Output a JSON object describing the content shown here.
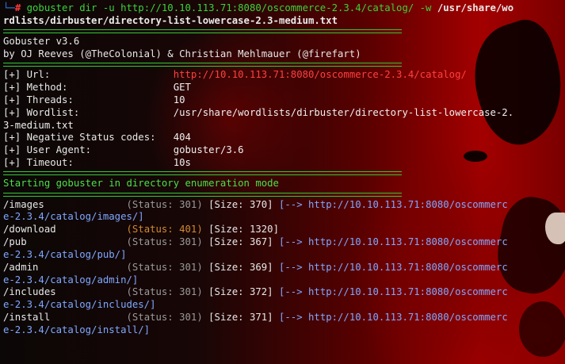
{
  "prompt": {
    "corner": "└─",
    "hash": "#",
    "command_start": "gobuster dir -u http://10.10.113.71:8080/oscommerce-2.3.4/catalog/ -w ",
    "wordlist_line1": "/usr/share/wo",
    "wordlist_line2": "rdlists/dirbuster/directory-list-lowercase-2.3-medium.txt"
  },
  "banner": {
    "version": "Gobuster v3.6",
    "authors": "by OJ Reeves (@TheColonial) & Christian Mehlmauer (@firefart)"
  },
  "config": [
    {
      "prefix": "[+] ",
      "label": "Url:                     ",
      "value": "http://10.10.113.71:8080/oscommerce-2.3.4/catalog/"
    },
    {
      "prefix": "[+] ",
      "label": "Method:                  ",
      "value": "GET"
    },
    {
      "prefix": "[+] ",
      "label": "Threads:                 ",
      "value": "10"
    },
    {
      "prefix": "[+] ",
      "label": "Wordlist:                ",
      "value": "/usr/share/wordlists/dirbuster/directory-list-lowercase-2.",
      "continuation": "3-medium.txt"
    },
    {
      "prefix": "[+] ",
      "label": "Negative Status codes:   ",
      "value": "404"
    },
    {
      "prefix": "[+] ",
      "label": "User Agent:              ",
      "value": "gobuster/3.6"
    },
    {
      "prefix": "[+] ",
      "label": "Timeout:                 ",
      "value": "10s"
    }
  ],
  "status_line": "Starting gobuster in directory enumeration mode",
  "results": [
    {
      "path": "/images              ",
      "status": "(Status: 301)",
      "size": " [Size: 370] ",
      "arrow": "[--> ",
      "redirect": "http://10.10.113.71:8080/oscommerc",
      "continuation": "e-2.3.4/catalog/images/]"
    },
    {
      "path": "/download            ",
      "status": "(Status: 401)",
      "size": " [Size: 1320]",
      "arrow": "",
      "redirect": "",
      "continuation": ""
    },
    {
      "path": "/pub                 ",
      "status": "(Status: 301)",
      "size": " [Size: 367] ",
      "arrow": "[--> ",
      "redirect": "http://10.10.113.71:8080/oscommerc",
      "continuation": "e-2.3.4/catalog/pub/]"
    },
    {
      "path": "/admin               ",
      "status": "(Status: 301)",
      "size": " [Size: 369] ",
      "arrow": "[--> ",
      "redirect": "http://10.10.113.71:8080/oscommerc",
      "continuation": "e-2.3.4/catalog/admin/]"
    },
    {
      "path": "/includes            ",
      "status": "(Status: 301)",
      "size": " [Size: 372] ",
      "arrow": "[--> ",
      "redirect": "http://10.10.113.71:8080/oscommerc",
      "continuation": "e-2.3.4/catalog/includes/]"
    },
    {
      "path": "/install             ",
      "status": "(Status: 301)",
      "size": " [Size: 371] ",
      "arrow": "[--> ",
      "redirect": "http://10.10.113.71:8080/oscommerc",
      "continuation": "e-2.3.4/catalog/install/]"
    }
  ],
  "colors": {
    "prompt_corner": "#2e7df5",
    "prompt_hash": "#ff3b3b",
    "command": "#3cd23c",
    "separator": "#37c837",
    "status_301": "#9a9a9a",
    "status_401": "#d08a30",
    "redirect_link": "#7fa8ff"
  }
}
